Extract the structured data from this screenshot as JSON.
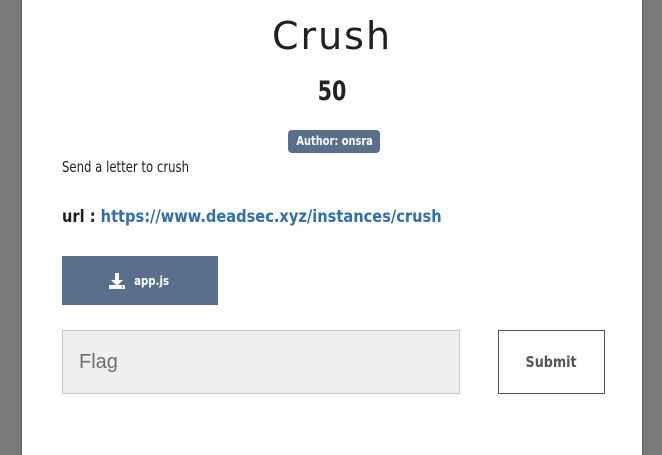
{
  "challenge": {
    "title": "Crush",
    "points": "50",
    "author_badge": "Author: onsra",
    "description": "Send a letter to crush",
    "url_label": "url :",
    "url": "https://www.deadsec.xyz/instances/crush"
  },
  "download": {
    "icon": "download-icon",
    "label": "app.js"
  },
  "flag_form": {
    "placeholder": "Flag",
    "value": "",
    "submit_label": "Submit"
  },
  "colors": {
    "badge_bg": "#5a6f8c",
    "link": "#2f6eb0",
    "input_bg": "#efefef"
  }
}
